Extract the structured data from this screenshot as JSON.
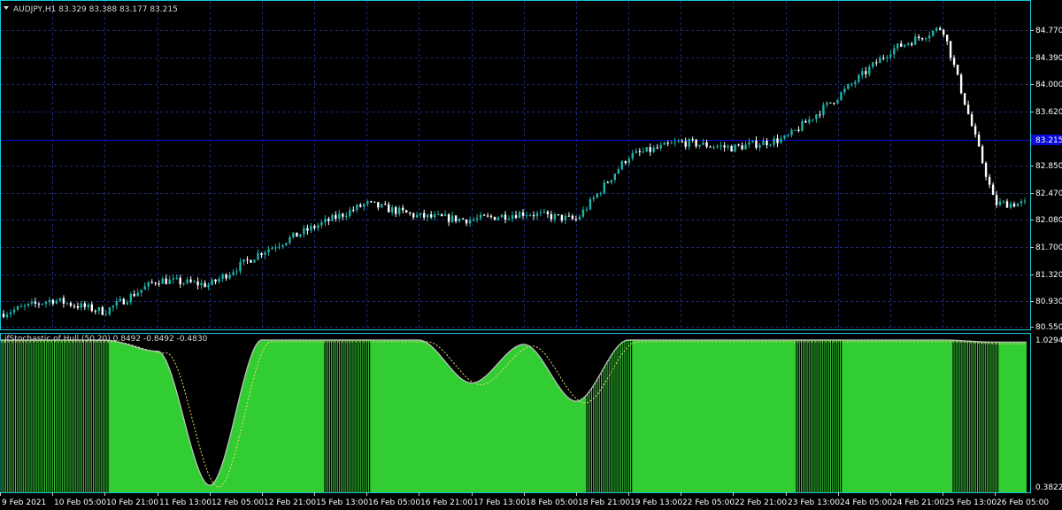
{
  "main": {
    "title": "AUDJPY,H1  83.329 83.388 83.177 83.215",
    "current_price": "83.215",
    "y_labels": [
      "84.770",
      "84.390",
      "84.000",
      "83.620",
      "83.215",
      "82.850",
      "82.470",
      "82.080",
      "81.700",
      "81.320",
      "80.930",
      "80.550"
    ],
    "colors": {
      "bull": "#20b2aa",
      "bear": "#ffffff",
      "grid": "#1e2a78",
      "border": "#16c8d8",
      "price_line": "#0a0ad8"
    }
  },
  "chart_data": {
    "type": "candlestick",
    "symbol": "AUDJPY",
    "timeframe": "H1",
    "price_range": [
      80.55,
      84.95
    ],
    "anchors": [
      {
        "time": "9 Feb 2021",
        "price": 80.72
      },
      {
        "time": "10 Feb 05:00",
        "price": 80.92
      },
      {
        "time": "10 Feb 21:00",
        "price": 80.75
      },
      {
        "time": "11 Feb 13:00",
        "price": 81.2
      },
      {
        "time": "12 Feb 05:00",
        "price": 81.13
      },
      {
        "time": "12 Feb 21:00",
        "price": 81.6
      },
      {
        "time": "15 Feb 13:00",
        "price": 81.95
      },
      {
        "time": "16 Feb 05:00",
        "price": 82.28
      },
      {
        "time": "16 Feb 21:00",
        "price": 82.1
      },
      {
        "time": "17 Feb 13:00",
        "price": 82.05
      },
      {
        "time": "18 Feb 05:00",
        "price": 82.15
      },
      {
        "time": "18 Feb 21:00",
        "price": 82.05
      },
      {
        "time": "19 Feb 13:00",
        "price": 82.95
      },
      {
        "time": "22 Feb 05:00",
        "price": 83.15
      },
      {
        "time": "22 Feb 21:00",
        "price": 83.07
      },
      {
        "time": "23 Feb 13:00",
        "price": 83.2
      },
      {
        "time": "24 Feb 05:00",
        "price": 83.8
      },
      {
        "time": "24 Feb 21:00",
        "price": 84.45
      },
      {
        "time": "25 Feb 13:00",
        "price": 84.78
      },
      {
        "time": "26 Feb 05:00",
        "price": 82.28
      }
    ],
    "x_labels": [
      "9 Feb 2021",
      "10 Feb 05:00",
      "10 Feb 21:00",
      "11 Feb 13:00",
      "12 Feb 05:00",
      "12 Feb 21:00",
      "15 Feb 13:00",
      "16 Feb 05:00",
      "16 Feb 21:00",
      "17 Feb 13:00",
      "18 Feb 05:00",
      "18 Feb 21:00",
      "19 Feb 13:00",
      "22 Feb 05:00",
      "22 Feb 21:00",
      "23 Feb 13:00",
      "24 Feb 05:00",
      "24 Feb 21:00",
      "25 Feb 13:00",
      "26 Feb 05:00"
    ]
  },
  "indicator": {
    "title": "jfStochastic of Hull (50,20)  0.8492 -0.8492 -0.4830",
    "y_labels": [
      "1.0294",
      "0.3822"
    ],
    "range": [
      0.3822,
      1.0294
    ],
    "colors": {
      "fill": "#32cd32",
      "main_line": "#c0c0c0",
      "signal_line": "#e8e070"
    },
    "main_anchors": [
      1.0294,
      1.0294,
      1.0294,
      0.98,
      0.39,
      1.0294,
      1.0294,
      1.0294,
      1.0294,
      0.84,
      1.01,
      0.76,
      1.0294,
      1.0294,
      1.0294,
      1.0294,
      1.0294,
      1.0294,
      1.0294,
      1.02
    ],
    "striped_ranges": [
      [
        "9 Feb 2021",
        "10 Feb 21:00"
      ],
      [
        "15 Feb 13:00",
        "16 Feb 05:00"
      ],
      [
        "18 Feb 21:00",
        "19 Feb 13:00"
      ],
      [
        "23 Feb 13:00",
        "24 Feb 05:00"
      ],
      [
        "25 Feb 13:00",
        "26 Feb 05:00"
      ]
    ]
  }
}
